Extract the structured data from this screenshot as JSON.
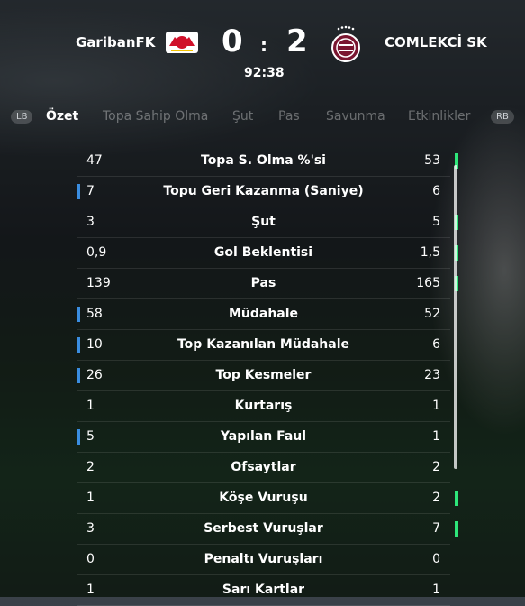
{
  "match": {
    "home_team": "GaribanFK",
    "away_team": "COMLEKCİ SK",
    "home_score": "0",
    "separator": ":",
    "away_score": "2",
    "clock": "92:38"
  },
  "tabs": {
    "lb": "LB",
    "rb": "RB",
    "items": [
      "Özet",
      "Topa Sahip Olma",
      "Şut",
      "Pas",
      "Savunma",
      "Etkinlikler"
    ],
    "active": "Özet"
  },
  "stats": [
    {
      "label": "Topa S. Olma %'si",
      "home": "47",
      "away": "53",
      "leader": "away"
    },
    {
      "label": "Topu Geri Kazanma (Saniye)",
      "home": "7",
      "away": "6",
      "leader": "home"
    },
    {
      "label": "Şut",
      "home": "3",
      "away": "5",
      "leader": "away"
    },
    {
      "label": "Gol Beklentisi",
      "home": "0,9",
      "away": "1,5",
      "leader": "away"
    },
    {
      "label": "Pas",
      "home": "139",
      "away": "165",
      "leader": "away"
    },
    {
      "label": "Müdahale",
      "home": "58",
      "away": "52",
      "leader": "home"
    },
    {
      "label": "Top Kazanılan Müdahale",
      "home": "10",
      "away": "6",
      "leader": "home"
    },
    {
      "label": "Top Kesmeler",
      "home": "26",
      "away": "23",
      "leader": "home"
    },
    {
      "label": "Kurtarış",
      "home": "1",
      "away": "1",
      "leader": "none"
    },
    {
      "label": "Yapılan Faul",
      "home": "5",
      "away": "1",
      "leader": "home"
    },
    {
      "label": "Ofsaytlar",
      "home": "2",
      "away": "2",
      "leader": "none"
    },
    {
      "label": "Köşe Vuruşu",
      "home": "1",
      "away": "2",
      "leader": "away"
    },
    {
      "label": "Serbest Vuruşlar",
      "home": "3",
      "away": "7",
      "leader": "away"
    },
    {
      "label": "Penaltı Vuruşları",
      "home": "0",
      "away": "0",
      "leader": "none"
    },
    {
      "label": "Sarı Kartlar",
      "home": "1",
      "away": "1",
      "leader": "none"
    }
  ],
  "colors": {
    "home_leader": "#3a8de0",
    "away_leader": "#2ee67a"
  }
}
